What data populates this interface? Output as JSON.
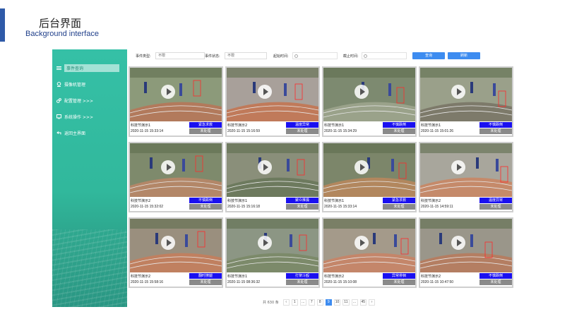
{
  "header": {
    "title_zh": "后台界面",
    "title_en": "Background interface",
    "accent_color": "#2f5aa8"
  },
  "sidebar": {
    "colors": {
      "bg": "#33bba0",
      "active_bg": "#b7e6db"
    },
    "items": [
      {
        "label": "事件查询",
        "icon": "list-icon",
        "active": true
      },
      {
        "label": "摄像机管理",
        "icon": "camera-pin-icon",
        "active": false
      },
      {
        "label": "配置管理 >>>",
        "icon": "gears-icon",
        "active": false
      },
      {
        "label": "系统操作 >>>",
        "icon": "monitor-icon",
        "active": false
      },
      {
        "label": "返回主界面",
        "icon": "return-icon",
        "active": false
      }
    ]
  },
  "filters": {
    "event_type_label": "事件类型:",
    "event_type_value": "不限",
    "event_status_label": "事件状态:",
    "event_status_value": "不限",
    "start_time_label": "起始时间:",
    "end_time_label": "截止时间:",
    "query_button": "查询",
    "refresh_button": "刷新",
    "button_color": "#3d8cf0"
  },
  "cards": [
    {
      "camera": "科技节演示1",
      "time": "2020-11-15 15:33:14",
      "event": "紧急求救",
      "status": "未处理"
    },
    {
      "camera": "科技节演示2",
      "time": "2020-11-15 15:16:59",
      "event": "温度异常",
      "status": "未处理"
    },
    {
      "camera": "科技节演示1",
      "time": "2020-11-15 15:34:29",
      "event": "不慎跌倒",
      "status": "未处理"
    },
    {
      "camera": "科技节演示1",
      "time": "2020-11-15 15:01:26",
      "event": "不慎跌倒",
      "status": "未处理"
    },
    {
      "camera": "科技节演示2",
      "time": "2020-11-15 15:32:02",
      "event": "不慎跌倒",
      "status": "未处理"
    },
    {
      "camera": "科技节演示1",
      "time": "2020-11-15 15:16:18",
      "event": "聚众推搡",
      "status": "未处理"
    },
    {
      "camera": "科技节演示1",
      "time": "2020-11-15 15:33:14",
      "event": "紧急求救",
      "status": "未处理"
    },
    {
      "camera": "科技节演示2",
      "time": "2020-11-15 14:59:11",
      "event": "温度异常",
      "status": "未处理"
    },
    {
      "camera": "科技节演示2",
      "time": "2020-11-15 15:58:16",
      "event": "翻时撩腿",
      "status": "未处理"
    },
    {
      "camera": "科技节演示1",
      "time": "2020-11-15 08:36:32",
      "event": "打架斗殴",
      "status": "未处理"
    },
    {
      "camera": "科技节演示2",
      "time": "2020-11-15 15:10:08",
      "event": "异常徘徊",
      "status": "未处理"
    },
    {
      "camera": "科技节演示2",
      "time": "2020-11-15 10:47:50",
      "event": "不慎跌倒",
      "status": "未处理"
    }
  ],
  "tag_colors": {
    "event": "#1a10f0",
    "status": "#8a8a8a"
  },
  "pagination": {
    "total": "共 630 条",
    "pages": [
      "‹",
      "1",
      "...",
      "7",
      "8",
      "9",
      "10",
      "11",
      "...",
      "45",
      "›"
    ],
    "active": "9"
  }
}
